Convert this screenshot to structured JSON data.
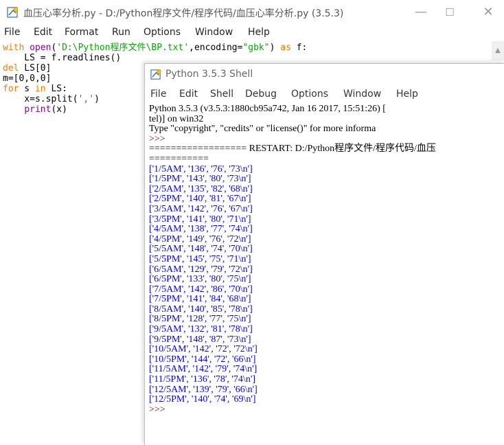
{
  "editor": {
    "title": "血压心率分析.py - D:/Python程序文件/程序代码/血压心率分析.py (3.5.3)",
    "menu": [
      "File",
      "Edit",
      "Format",
      "Run",
      "Options",
      "Window",
      "Help"
    ],
    "code": {
      "line1": {
        "kw": "with",
        "fn": "open",
        "p1": "(",
        "str": "'D:\\Python程序文件\\BP.txt'",
        "p2": ",encoding=",
        "str2": "\"gbk\"",
        "p3": ") ",
        "kw2": "as",
        "p4": " f:"
      },
      "line2": "    LS = f.readlines()",
      "line3": {
        "kw": "del",
        "rest": " LS[0]"
      },
      "line4": "m=[0,0,0]",
      "line5": {
        "kw": "for",
        "a": " s ",
        "kw2": "in",
        "b": " LS:"
      },
      "line6": {
        "a": "    x=s.split(",
        "str": "','",
        "b": ")"
      },
      "line7": {
        "indent": "    ",
        "fn": "print",
        "b": "(x)"
      }
    },
    "controls": {
      "minimize": "—",
      "maximize": "☐",
      "close": "✕"
    }
  },
  "shell": {
    "title": "Python 3.5.3 Shell",
    "menu": [
      "File",
      "Edit",
      "Shell",
      "Debug",
      "Options",
      "Window",
      "Help"
    ],
    "banner1": "Python 3.5.3 (v3.5.3:1880cb95a742, Jan 16 2017, 15:51:26) [",
    "banner2": "tel)] on win32",
    "banner3": "Type \"copyright\", \"credits\" or \"license()\" for more informa",
    "prompt1": ">>> ",
    "restart": "================== RESTART: D:/Python程序文件/程序代码/血压",
    "restart2": "===========",
    "output": [
      "['1/5AM', '136', '76', '73\\n']",
      "['1/5PM', '143', '80', '73\\n']",
      "['2/5AM', '135', '82', '68\\n']",
      "['2/5PM', '140', '81', '67\\n']",
      "['3/5AM', '142', '76', '67\\n']",
      "['3/5PM', '141', '80', '71\\n']",
      "['4/5AM', '138', '77', '74\\n']",
      "['4/5PM', '149', '76', '72\\n']",
      "['5/5AM', '148', '74', '70\\n']",
      "['5/5PM', '145', '75', '71\\n']",
      "['6/5AM', '129', '79', '72\\n']",
      "['6/5PM', '133', '80', '75\\n']",
      "['7/5AM', '142', '86', '70\\n']",
      "['7/5PM', '141', '84', '68\\n']",
      "['8/5AM', '140', '85', '78\\n']",
      "['8/5PM', '128', '77', '75\\n']",
      "['9/5AM', '132', '81', '78\\n']",
      "['9/5PM', '148', '87', '73\\n']",
      "['10/5AM', '142', '72', '72\\n']",
      "['10/5PM', '144', '72', '66\\n']",
      "['11/5AM', '142', '79', '74\\n']",
      "['11/5PM', '136', '78', '74\\n']",
      "['12/5AM', '139', '79', '66\\n']",
      "['12/5PM', '140', '74', '69\\n']"
    ],
    "prompt2": ">>> "
  }
}
